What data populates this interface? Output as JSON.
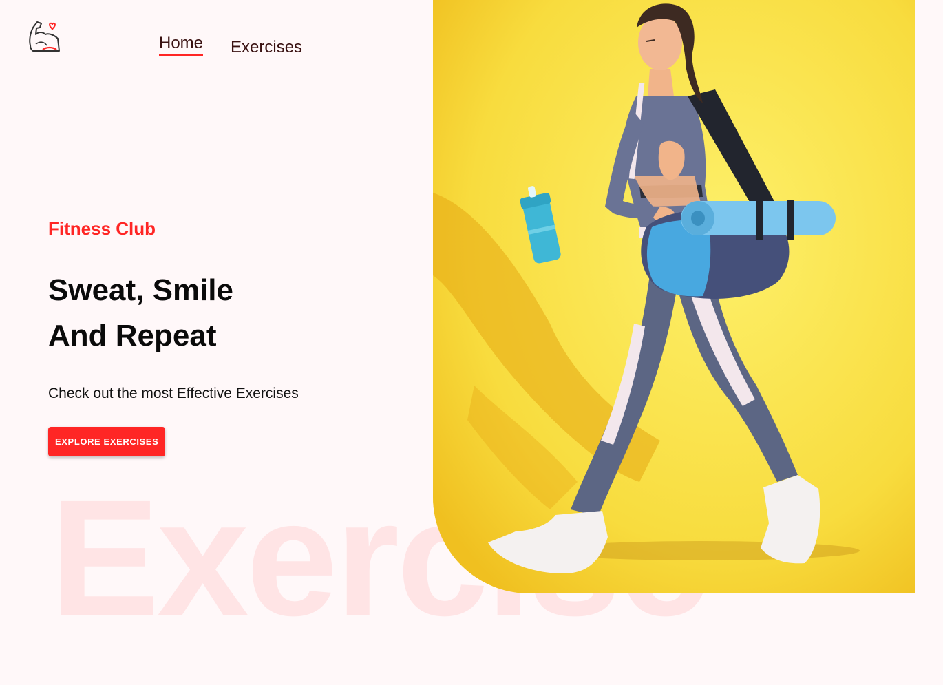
{
  "brand": {
    "logo_icon": "flexed-arm-heart-icon"
  },
  "nav": {
    "items": [
      {
        "label": "Home",
        "active": true
      },
      {
        "label": "Exercises",
        "active": false
      }
    ]
  },
  "hero": {
    "eyebrow": "Fitness Club",
    "headline_line1": "Sweat, Smile",
    "headline_line2": "And Repeat",
    "subtitle": "Check out the most Effective Exercises",
    "cta_label": "Explore Exercises",
    "watermark": "Exercise"
  },
  "banner": {
    "image": "woman-walking-with-gym-bag-and-shaker"
  },
  "colors": {
    "accent": "#ff2625",
    "background": "#fff8f9",
    "banner_bg": "#f9e04b",
    "text": "#0a0a0a"
  }
}
